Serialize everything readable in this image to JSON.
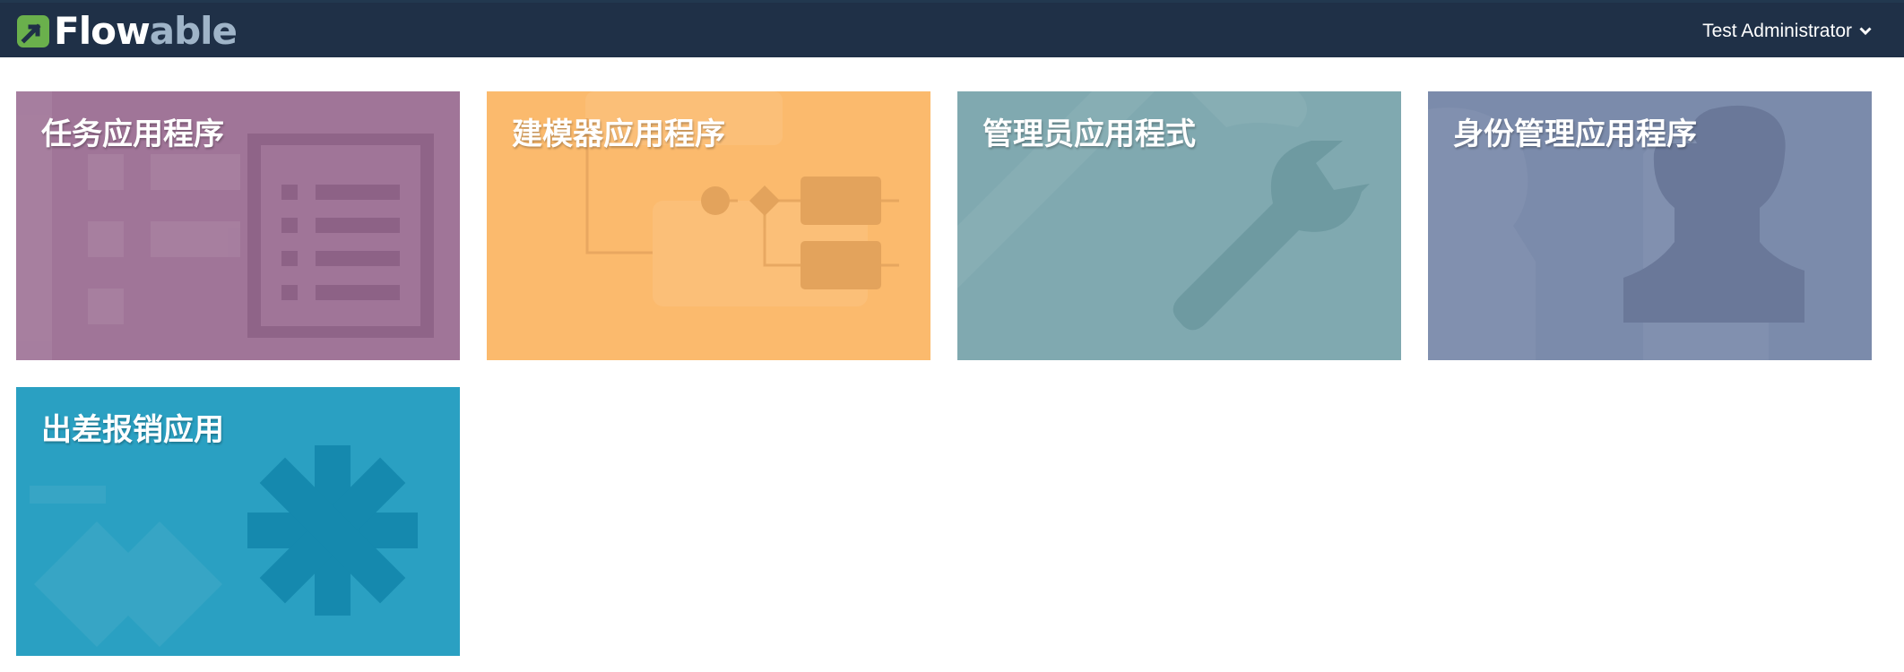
{
  "header": {
    "logo_text_1": "Flow",
    "logo_text_2": "able",
    "user_name": "Test Administrator"
  },
  "apps": [
    {
      "title": "任务应用程序",
      "color": "#a07598",
      "icon": "list-icon"
    },
    {
      "title": "建模器应用程序",
      "color": "#fbba6d",
      "icon": "process-diagram-icon"
    },
    {
      "title": "管理员应用程式",
      "color": "#80a9b0",
      "icon": "wrench-icon"
    },
    {
      "title": "身份管理应用程序",
      "color": "#7b8bab",
      "icon": "user-icon"
    },
    {
      "title": "出差报销应用",
      "color": "#2aa0c2",
      "icon": "asterisk-icon"
    }
  ]
}
